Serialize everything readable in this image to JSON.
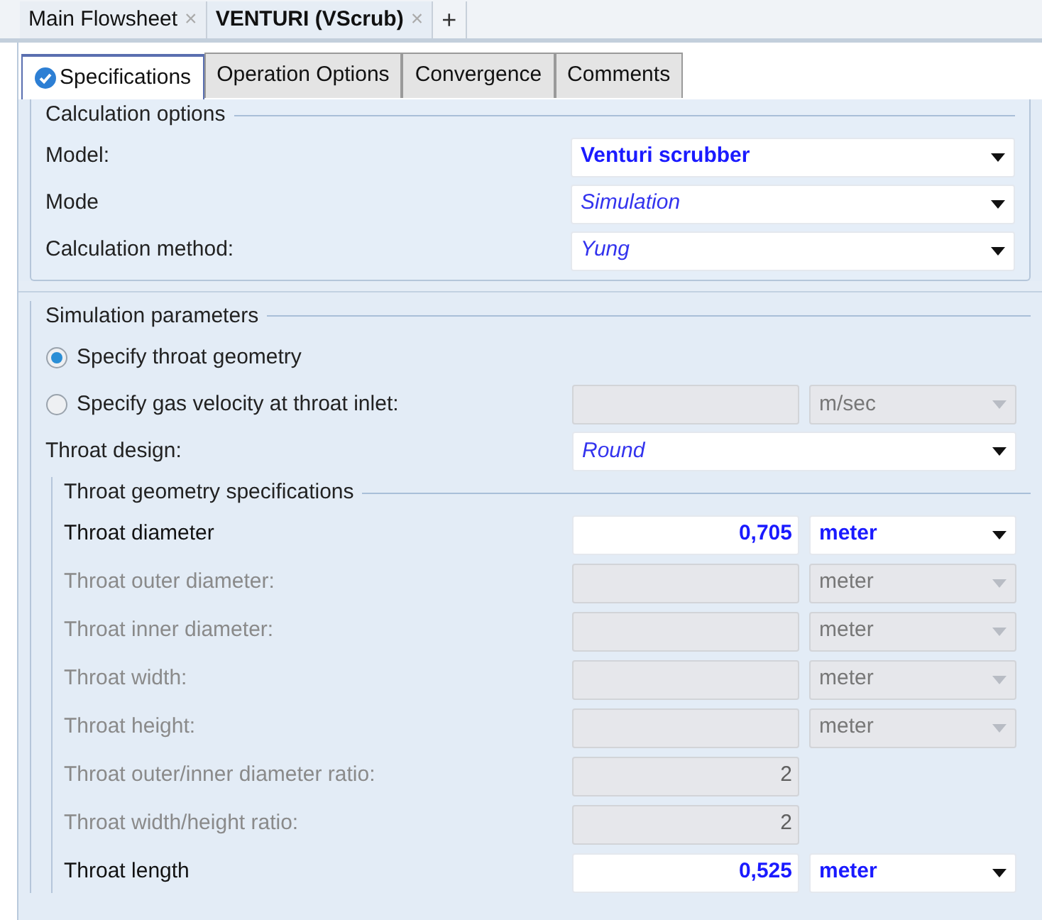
{
  "doc_tabs": [
    {
      "label": "Main Flowsheet",
      "selected": false,
      "close": "×"
    },
    {
      "label": "VENTURI (VScrub)",
      "selected": true,
      "close": "×"
    }
  ],
  "add_tab": "+",
  "form_tabs": [
    {
      "label": "Specifications",
      "selected": true,
      "complete": true
    },
    {
      "label": "Operation Options",
      "selected": false,
      "complete": false
    },
    {
      "label": "Convergence",
      "selected": false,
      "complete": false
    },
    {
      "label": "Comments",
      "selected": false,
      "complete": false
    }
  ],
  "calculation_options": {
    "title": "Calculation options",
    "rows": [
      {
        "label": "Model:",
        "value": "Venturi scrubber",
        "kind": "bold"
      },
      {
        "label": "Mode",
        "value": "Simulation",
        "kind": "italic"
      },
      {
        "label": "Calculation method:",
        "value": "Yung",
        "kind": "italic"
      }
    ]
  },
  "simulation_parameters": {
    "title": "Simulation parameters",
    "options": [
      {
        "label": "Specify throat geometry",
        "selected": true
      },
      {
        "label": "Specify gas velocity at throat inlet:",
        "selected": false,
        "unit": "m/sec"
      }
    ],
    "throat_design": {
      "label": "Throat design:",
      "value": "Round"
    },
    "geometry": {
      "title": "Throat geometry specifications",
      "rows": [
        {
          "label": "Throat diameter",
          "enabled": true,
          "value": "0,705",
          "unit": "meter"
        },
        {
          "label": "Throat outer diameter:",
          "enabled": false,
          "unit": "meter"
        },
        {
          "label": "Throat inner diameter:",
          "enabled": false,
          "unit": "meter"
        },
        {
          "label": "Throat width:",
          "enabled": false,
          "unit": "meter"
        },
        {
          "label": "Throat height:",
          "enabled": false,
          "unit": "meter"
        },
        {
          "label": "Throat outer/inner diameter ratio:",
          "enabled": false,
          "value": "2"
        },
        {
          "label": "Throat width/height ratio:",
          "enabled": false,
          "value": "2"
        },
        {
          "label": "Throat length",
          "enabled": true,
          "value": "0,525",
          "unit": "meter"
        }
      ]
    }
  }
}
